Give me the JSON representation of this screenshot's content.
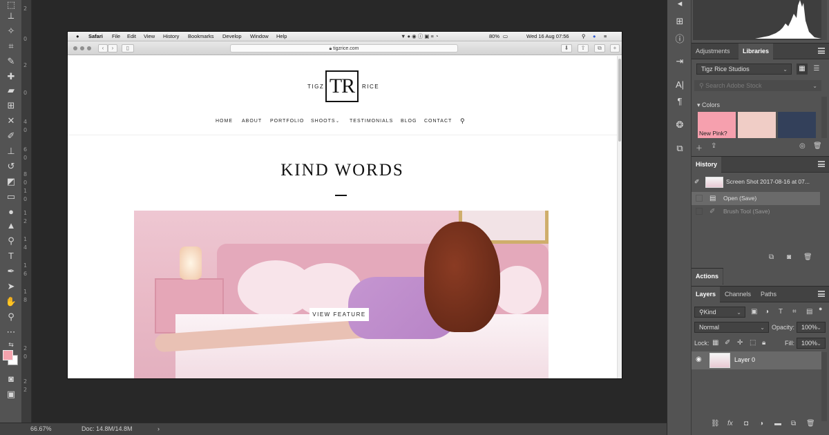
{
  "photoshop": {
    "status": {
      "zoom": "66.67%",
      "doc": "Doc: 14.8M/14.8M",
      "arrow": "›"
    },
    "ruler_ticks": [
      "2",
      "0",
      "2",
      "0",
      "4",
      "0",
      "6",
      "0",
      "8",
      "0",
      "1",
      "0",
      "1",
      "2",
      "1",
      "4",
      "1",
      "6",
      "1",
      "8",
      "2",
      "0",
      "2",
      "2"
    ],
    "colors": {
      "foreground": "#f4a3ad",
      "background": "#ffffff",
      "swatch_1": "#f6a0ae",
      "swatch_2": "#f0cdc6",
      "swatch_3": "#33405a"
    }
  },
  "screenshot": {
    "menubar": {
      "apple": "",
      "app": "Safari",
      "items": [
        "File",
        "Edit",
        "View",
        "History",
        "Bookmarks",
        "Develop",
        "Window",
        "Help"
      ],
      "battery": "80%",
      "datetime": "Wed 16 Aug  07:56"
    },
    "browser": {
      "url": "tigzrice.com",
      "back": "‹",
      "forward": "›"
    },
    "site": {
      "logo_left": "TIGZ",
      "logo_mark": "TR",
      "logo_right": "RICE",
      "nav": [
        "HOME",
        "ABOUT",
        "PORTFOLIO",
        "SHOOTS",
        "TESTIMONIALS",
        "BLOG",
        "CONTACT"
      ],
      "heading": "KIND WORDS",
      "feature_button": "VIEW FEATURE"
    }
  },
  "panels": {
    "libraries_tabs": [
      "Adjustments",
      "Libraries"
    ],
    "library_name": "Tigz Rice Studios",
    "search_placeholder": "Search Adobe Stock",
    "colors_heading": "Colors",
    "swatch_1_label": "New Pink?",
    "history_tab": "History",
    "history_snapshot": "Screen Shot 2017-08-16 at 07...",
    "history_items": [
      "Open (Save)",
      "Brush Tool (Save)"
    ],
    "actions_tab": "Actions",
    "layers_tabs": [
      "Layers",
      "Channels",
      "Paths"
    ],
    "kind_filter": "Kind",
    "blend_mode": "Normal",
    "opacity_label": "Opacity:",
    "opacity_value": "100%",
    "lock_label": "Lock:",
    "fill_label": "Fill:",
    "fill_value": "100%",
    "layer_name": "Layer 0"
  }
}
